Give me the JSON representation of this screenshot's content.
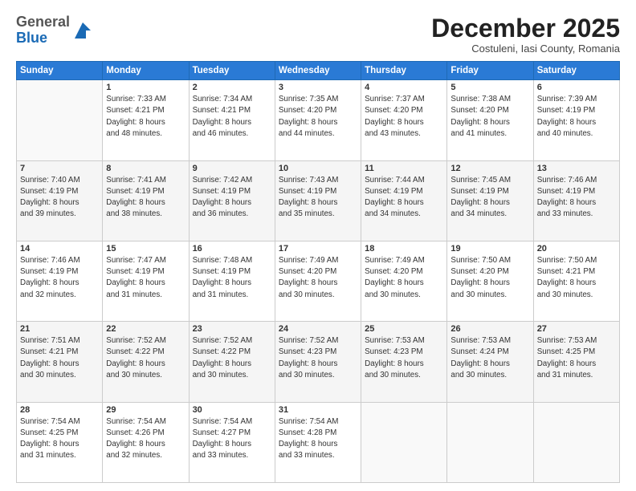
{
  "header": {
    "logo_general": "General",
    "logo_blue": "Blue",
    "month_title": "December 2025",
    "location": "Costuleni, Iasi County, Romania"
  },
  "days_of_week": [
    "Sunday",
    "Monday",
    "Tuesday",
    "Wednesday",
    "Thursday",
    "Friday",
    "Saturday"
  ],
  "weeks": [
    [
      {
        "day": "",
        "content": ""
      },
      {
        "day": "1",
        "content": "Sunrise: 7:33 AM\nSunset: 4:21 PM\nDaylight: 8 hours\nand 48 minutes."
      },
      {
        "day": "2",
        "content": "Sunrise: 7:34 AM\nSunset: 4:21 PM\nDaylight: 8 hours\nand 46 minutes."
      },
      {
        "day": "3",
        "content": "Sunrise: 7:35 AM\nSunset: 4:20 PM\nDaylight: 8 hours\nand 44 minutes."
      },
      {
        "day": "4",
        "content": "Sunrise: 7:37 AM\nSunset: 4:20 PM\nDaylight: 8 hours\nand 43 minutes."
      },
      {
        "day": "5",
        "content": "Sunrise: 7:38 AM\nSunset: 4:20 PM\nDaylight: 8 hours\nand 41 minutes."
      },
      {
        "day": "6",
        "content": "Sunrise: 7:39 AM\nSunset: 4:19 PM\nDaylight: 8 hours\nand 40 minutes."
      }
    ],
    [
      {
        "day": "7",
        "content": "Sunrise: 7:40 AM\nSunset: 4:19 PM\nDaylight: 8 hours\nand 39 minutes."
      },
      {
        "day": "8",
        "content": "Sunrise: 7:41 AM\nSunset: 4:19 PM\nDaylight: 8 hours\nand 38 minutes."
      },
      {
        "day": "9",
        "content": "Sunrise: 7:42 AM\nSunset: 4:19 PM\nDaylight: 8 hours\nand 36 minutes."
      },
      {
        "day": "10",
        "content": "Sunrise: 7:43 AM\nSunset: 4:19 PM\nDaylight: 8 hours\nand 35 minutes."
      },
      {
        "day": "11",
        "content": "Sunrise: 7:44 AM\nSunset: 4:19 PM\nDaylight: 8 hours\nand 34 minutes."
      },
      {
        "day": "12",
        "content": "Sunrise: 7:45 AM\nSunset: 4:19 PM\nDaylight: 8 hours\nand 34 minutes."
      },
      {
        "day": "13",
        "content": "Sunrise: 7:46 AM\nSunset: 4:19 PM\nDaylight: 8 hours\nand 33 minutes."
      }
    ],
    [
      {
        "day": "14",
        "content": "Sunrise: 7:46 AM\nSunset: 4:19 PM\nDaylight: 8 hours\nand 32 minutes."
      },
      {
        "day": "15",
        "content": "Sunrise: 7:47 AM\nSunset: 4:19 PM\nDaylight: 8 hours\nand 31 minutes."
      },
      {
        "day": "16",
        "content": "Sunrise: 7:48 AM\nSunset: 4:19 PM\nDaylight: 8 hours\nand 31 minutes."
      },
      {
        "day": "17",
        "content": "Sunrise: 7:49 AM\nSunset: 4:20 PM\nDaylight: 8 hours\nand 30 minutes."
      },
      {
        "day": "18",
        "content": "Sunrise: 7:49 AM\nSunset: 4:20 PM\nDaylight: 8 hours\nand 30 minutes."
      },
      {
        "day": "19",
        "content": "Sunrise: 7:50 AM\nSunset: 4:20 PM\nDaylight: 8 hours\nand 30 minutes."
      },
      {
        "day": "20",
        "content": "Sunrise: 7:50 AM\nSunset: 4:21 PM\nDaylight: 8 hours\nand 30 minutes."
      }
    ],
    [
      {
        "day": "21",
        "content": "Sunrise: 7:51 AM\nSunset: 4:21 PM\nDaylight: 8 hours\nand 30 minutes."
      },
      {
        "day": "22",
        "content": "Sunrise: 7:52 AM\nSunset: 4:22 PM\nDaylight: 8 hours\nand 30 minutes."
      },
      {
        "day": "23",
        "content": "Sunrise: 7:52 AM\nSunset: 4:22 PM\nDaylight: 8 hours\nand 30 minutes."
      },
      {
        "day": "24",
        "content": "Sunrise: 7:52 AM\nSunset: 4:23 PM\nDaylight: 8 hours\nand 30 minutes."
      },
      {
        "day": "25",
        "content": "Sunrise: 7:53 AM\nSunset: 4:23 PM\nDaylight: 8 hours\nand 30 minutes."
      },
      {
        "day": "26",
        "content": "Sunrise: 7:53 AM\nSunset: 4:24 PM\nDaylight: 8 hours\nand 30 minutes."
      },
      {
        "day": "27",
        "content": "Sunrise: 7:53 AM\nSunset: 4:25 PM\nDaylight: 8 hours\nand 31 minutes."
      }
    ],
    [
      {
        "day": "28",
        "content": "Sunrise: 7:54 AM\nSunset: 4:25 PM\nDaylight: 8 hours\nand 31 minutes."
      },
      {
        "day": "29",
        "content": "Sunrise: 7:54 AM\nSunset: 4:26 PM\nDaylight: 8 hours\nand 32 minutes."
      },
      {
        "day": "30",
        "content": "Sunrise: 7:54 AM\nSunset: 4:27 PM\nDaylight: 8 hours\nand 33 minutes."
      },
      {
        "day": "31",
        "content": "Sunrise: 7:54 AM\nSunset: 4:28 PM\nDaylight: 8 hours\nand 33 minutes."
      },
      {
        "day": "",
        "content": ""
      },
      {
        "day": "",
        "content": ""
      },
      {
        "day": "",
        "content": ""
      }
    ]
  ]
}
